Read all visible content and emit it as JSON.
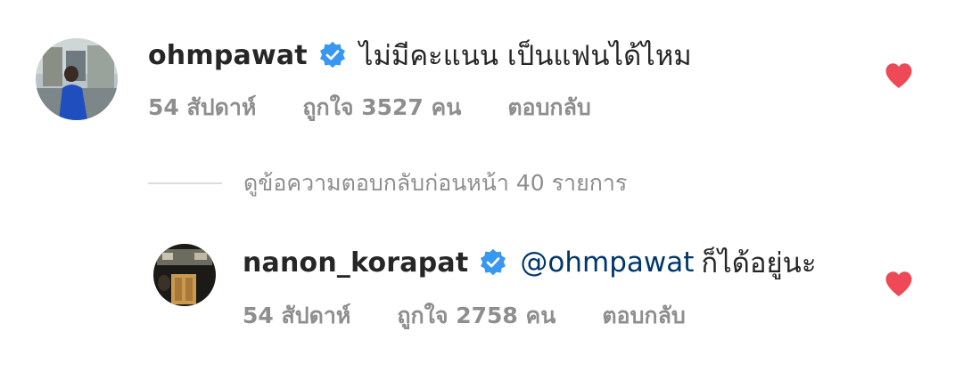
{
  "comments": [
    {
      "username": "ohmpawat",
      "text": "ไม่มีคะแนน เป็นแฟนได้ไหม",
      "mention": "",
      "age": "54 สัปดาห์",
      "likes": "ถูกใจ 3527 คน",
      "reply_label": "ตอบกลับ",
      "verified": true,
      "liked": true
    },
    {
      "username": "nanon_korapat",
      "text": "ก็ได้อยู่นะ",
      "mention": "@ohmpawat",
      "age": "54 สัปดาห์",
      "likes": "ถูกใจ 2758 คน",
      "reply_label": "ตอบกลับ",
      "verified": true,
      "liked": true
    }
  ],
  "view_replies": "ดูข้อความตอบกลับก่อนหน้า 40 รายการ",
  "colors": {
    "heart": "#ed4956",
    "verified": "#3897f0",
    "mention": "#00376b",
    "muted": "#8e8e8e",
    "text": "#262626"
  },
  "icons": {
    "verified": "verified-badge-icon",
    "like": "heart-icon"
  }
}
